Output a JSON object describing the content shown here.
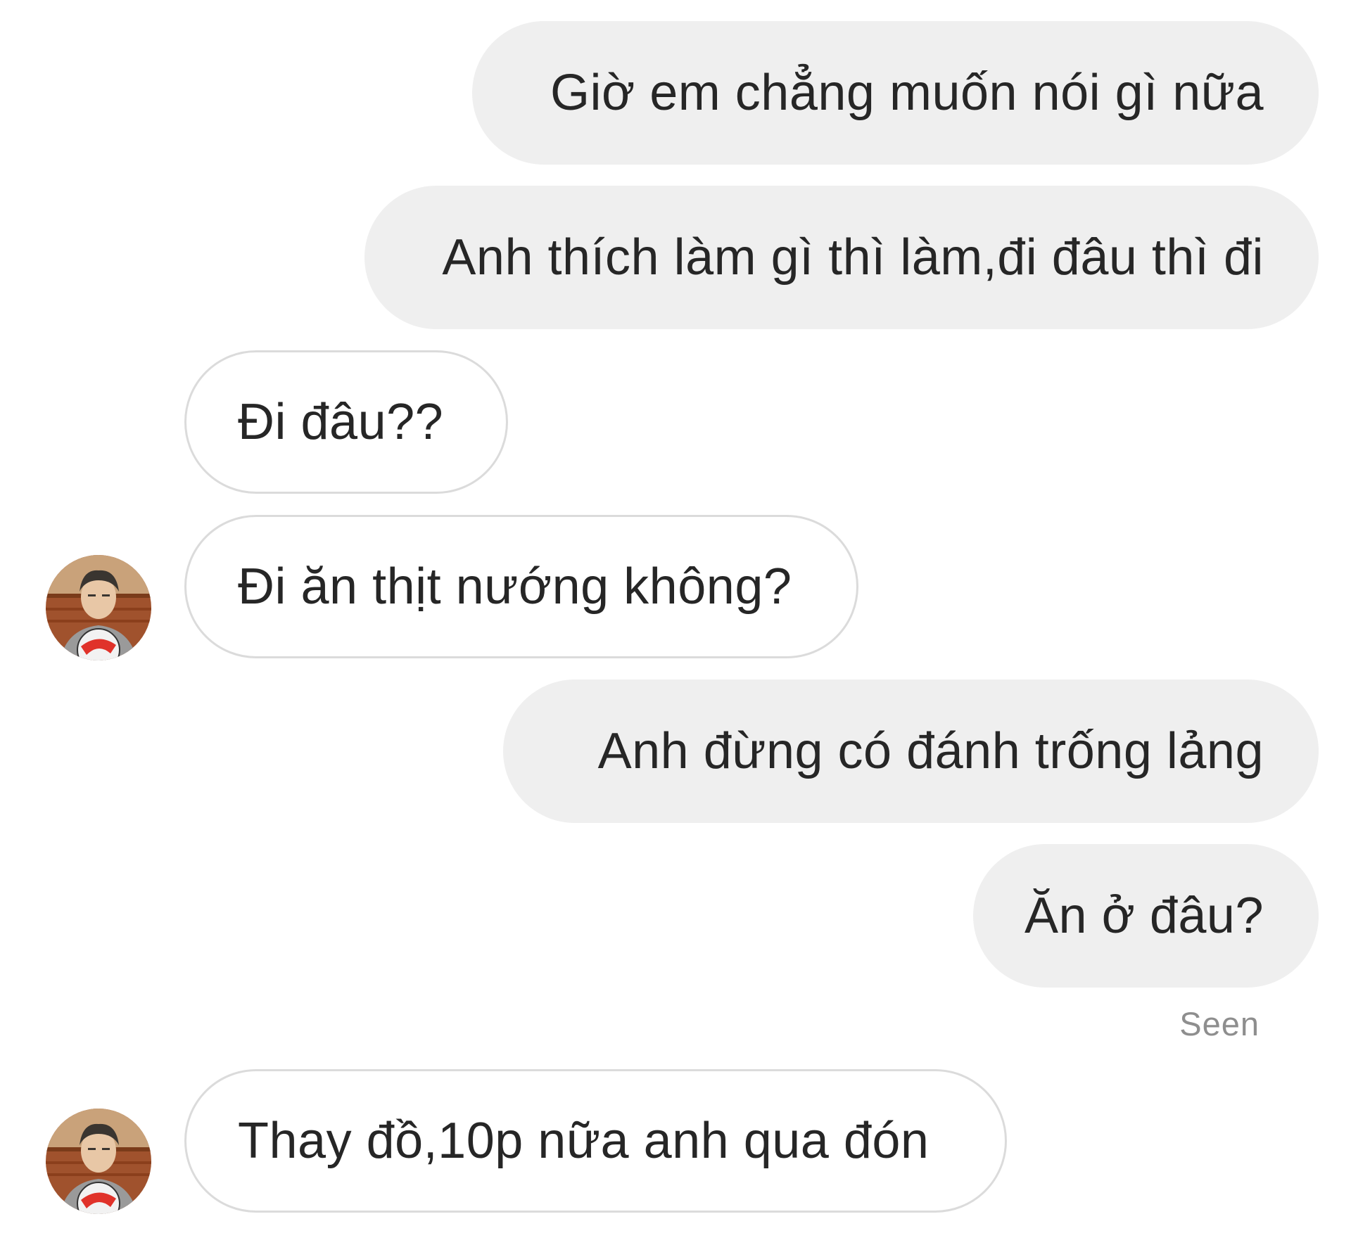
{
  "thread": {
    "messages": [
      {
        "sender": "me",
        "text": "Giờ em chẳng muốn nói gì nữa"
      },
      {
        "sender": "me",
        "text": "Anh thích làm gì thì làm,đi đâu thì đi"
      },
      {
        "sender": "them",
        "text": "Đi đâu??"
      },
      {
        "sender": "them",
        "text": "Đi ăn thịt nướng không?",
        "show_avatar": true
      },
      {
        "sender": "me",
        "text": "Anh đừng có đánh trống lảng"
      },
      {
        "sender": "me",
        "text": "Ăn ở đâu?"
      },
      {
        "sender": "them",
        "text": "Thay đồ,10p nữa anh qua đón",
        "show_avatar": true
      }
    ],
    "read_receipt": "Seen"
  },
  "colors": {
    "sent_bubble_bg": "#efefef",
    "received_bubble_border": "#dbdbdb",
    "text": "#262626",
    "seen_text": "#8e8e8e"
  }
}
